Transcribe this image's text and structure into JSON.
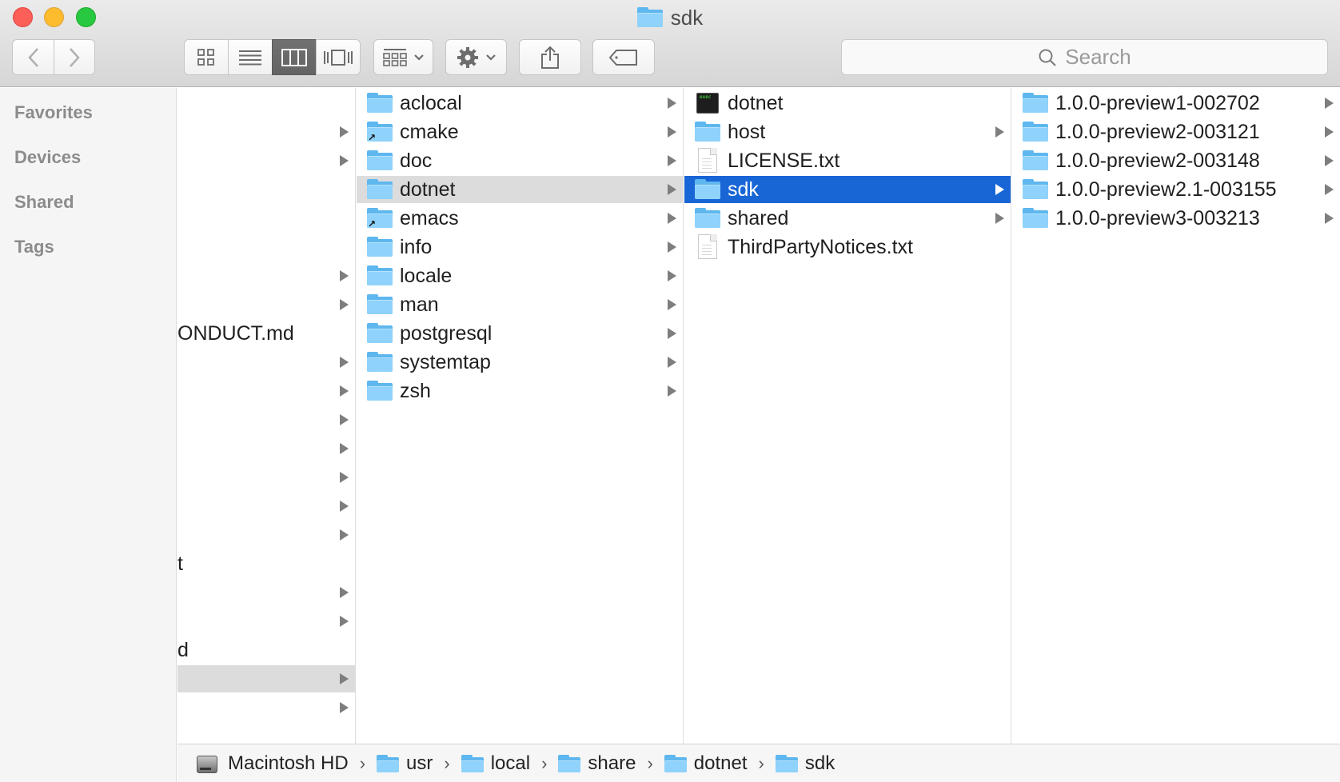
{
  "window": {
    "title": "sdk"
  },
  "toolbar": {
    "search_placeholder": "Search",
    "view_mode_active": "columns"
  },
  "sidebar": {
    "sections": [
      "Favorites",
      "Devices",
      "Shared",
      "Tags"
    ]
  },
  "column1": {
    "visible_fragments": [
      {
        "label": "",
        "arrow": true
      },
      {
        "label": "",
        "arrow": true
      },
      {
        "label": "",
        "arrow": true
      },
      {
        "label": "",
        "arrow": true
      },
      {
        "label": "ONDUCT.md",
        "arrow": false
      },
      {
        "label": "",
        "arrow": true
      },
      {
        "label": "",
        "arrow": true
      },
      {
        "label": "",
        "arrow": true
      },
      {
        "label": "",
        "arrow": true
      },
      {
        "label": "",
        "arrow": true
      },
      {
        "label": "",
        "arrow": true
      },
      {
        "label": "",
        "arrow": true
      },
      {
        "label": "t",
        "arrow": false
      },
      {
        "label": "",
        "arrow": true
      },
      {
        "label": "",
        "arrow": true
      },
      {
        "label": "d",
        "arrow": false
      },
      {
        "label": "",
        "arrow": true
      },
      {
        "label": "",
        "arrow": true
      }
    ]
  },
  "column2": {
    "items": [
      {
        "label": "aclocal",
        "kind": "folder"
      },
      {
        "label": "cmake",
        "kind": "alias"
      },
      {
        "label": "doc",
        "kind": "folder"
      },
      {
        "label": "dotnet",
        "kind": "folder"
      },
      {
        "label": "emacs",
        "kind": "alias"
      },
      {
        "label": "info",
        "kind": "folder"
      },
      {
        "label": "locale",
        "kind": "folder"
      },
      {
        "label": "man",
        "kind": "folder"
      },
      {
        "label": "postgresql",
        "kind": "folder"
      },
      {
        "label": "systemtap",
        "kind": "folder"
      },
      {
        "label": "zsh",
        "kind": "folder"
      }
    ]
  },
  "column3": {
    "items": [
      {
        "label": "dotnet",
        "kind": "exec"
      },
      {
        "label": "host",
        "kind": "folder"
      },
      {
        "label": "LICENSE.txt",
        "kind": "doc"
      },
      {
        "label": "sdk",
        "kind": "folder"
      },
      {
        "label": "shared",
        "kind": "folder"
      },
      {
        "label": "ThirdPartyNotices.txt",
        "kind": "doc"
      }
    ]
  },
  "column4": {
    "items": [
      {
        "label": "1.0.0-preview1-002702"
      },
      {
        "label": "1.0.0-preview2-003121"
      },
      {
        "label": "1.0.0-preview2-003148"
      },
      {
        "label": "1.0.0-preview2.1-003155"
      },
      {
        "label": "1.0.0-preview3-003213"
      }
    ]
  },
  "pathbar": {
    "crumbs": [
      "Macintosh HD",
      "usr",
      "local",
      "share",
      "dotnet",
      "sdk"
    ],
    "separator": "›"
  },
  "colors": {
    "selection": "#1866d6",
    "path_highlight": "#dcdcdc",
    "folder": "#8fd2fb"
  }
}
